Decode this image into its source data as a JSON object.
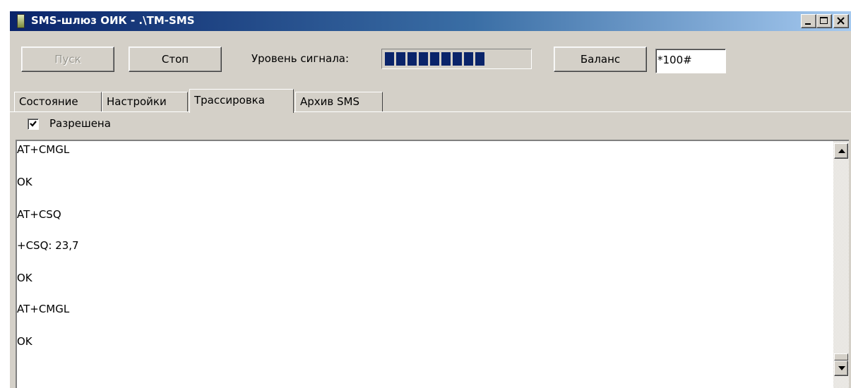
{
  "window": {
    "title": "SMS-шлюз ОИК - .\\TM-SMS",
    "controls": [
      "minimize-icon",
      "maximize-icon",
      "close-icon"
    ]
  },
  "toolbar": {
    "start_label": "Пуск",
    "stop_label": "Стоп",
    "signal_label": "Уровень сигнала:",
    "signal_segments": 9,
    "balance_label": "Баланс",
    "ussd_value": "*100#"
  },
  "tabs": [
    {
      "label": "Состояние",
      "active": false
    },
    {
      "label": "Настройки",
      "active": false
    },
    {
      "label": "Трассировка",
      "active": true
    },
    {
      "label": "Архив SMS",
      "active": false
    }
  ],
  "trace": {
    "enabled_label": "Разрешена",
    "enabled": true,
    "lines": [
      "AT+CMGL",
      "OK",
      "AT+CSQ",
      "+CSQ: 23,7",
      "OK",
      "AT+CMGL",
      "OK"
    ]
  },
  "colors": {
    "face": "#d4d0c8",
    "title_start": "#0a246a",
    "title_end": "#a6caf0",
    "signal_fill": "#0a246a"
  },
  "icons": {
    "app": "sms-gateway-icon",
    "check": "check-icon",
    "scroll_up": "arrow-up-icon",
    "scroll_down": "arrow-down-icon"
  }
}
